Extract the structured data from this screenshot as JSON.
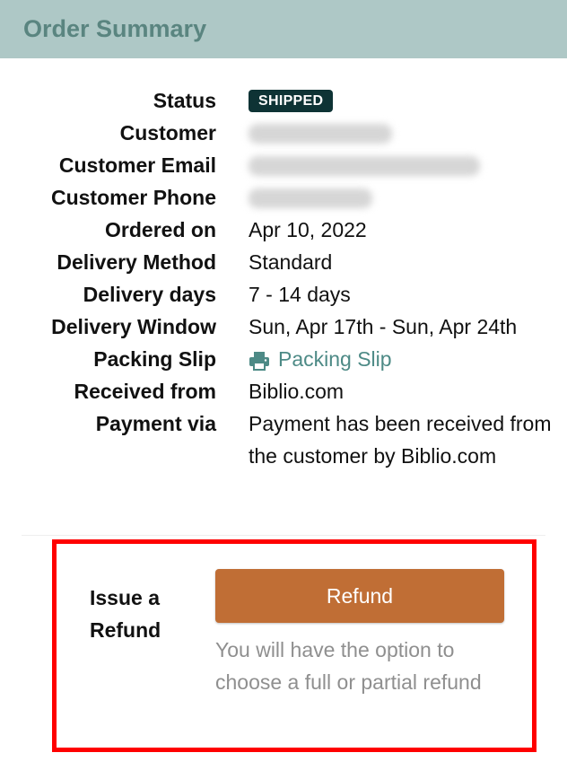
{
  "header": {
    "title": "Order Summary"
  },
  "order": {
    "status_label": "Status",
    "status_value": "SHIPPED",
    "customer_label": "Customer",
    "customer_email_label": "Customer Email",
    "customer_phone_label": "Customer Phone",
    "ordered_on_label": "Ordered on",
    "ordered_on_value": "Apr 10, 2022",
    "delivery_method_label": "Delivery Method",
    "delivery_method_value": "Standard",
    "delivery_days_label": "Delivery days",
    "delivery_days_value": "7 - 14 days",
    "delivery_window_label": "Delivery Window",
    "delivery_window_value": "Sun, Apr 17th - Sun, Apr 24th",
    "packing_slip_label": "Packing Slip",
    "packing_slip_link": "Packing Slip",
    "received_from_label": "Received from",
    "received_from_value": "Biblio.com",
    "payment_via_label": "Payment via",
    "payment_via_value": "Payment has been received from the customer by Biblio.com"
  },
  "refund": {
    "label": "Issue a Refund",
    "button_label": "Refund",
    "help_text": "You will have the option to choose a full or partial refund"
  },
  "colors": {
    "header_bg": "#aec8c6",
    "header_text": "#5a8580",
    "badge_bg": "#0e3335",
    "link": "#4d8a86",
    "refund_button": "#c06e35",
    "highlight_border": "#ff0000"
  },
  "icons": {
    "packing_slip": "print-icon"
  }
}
